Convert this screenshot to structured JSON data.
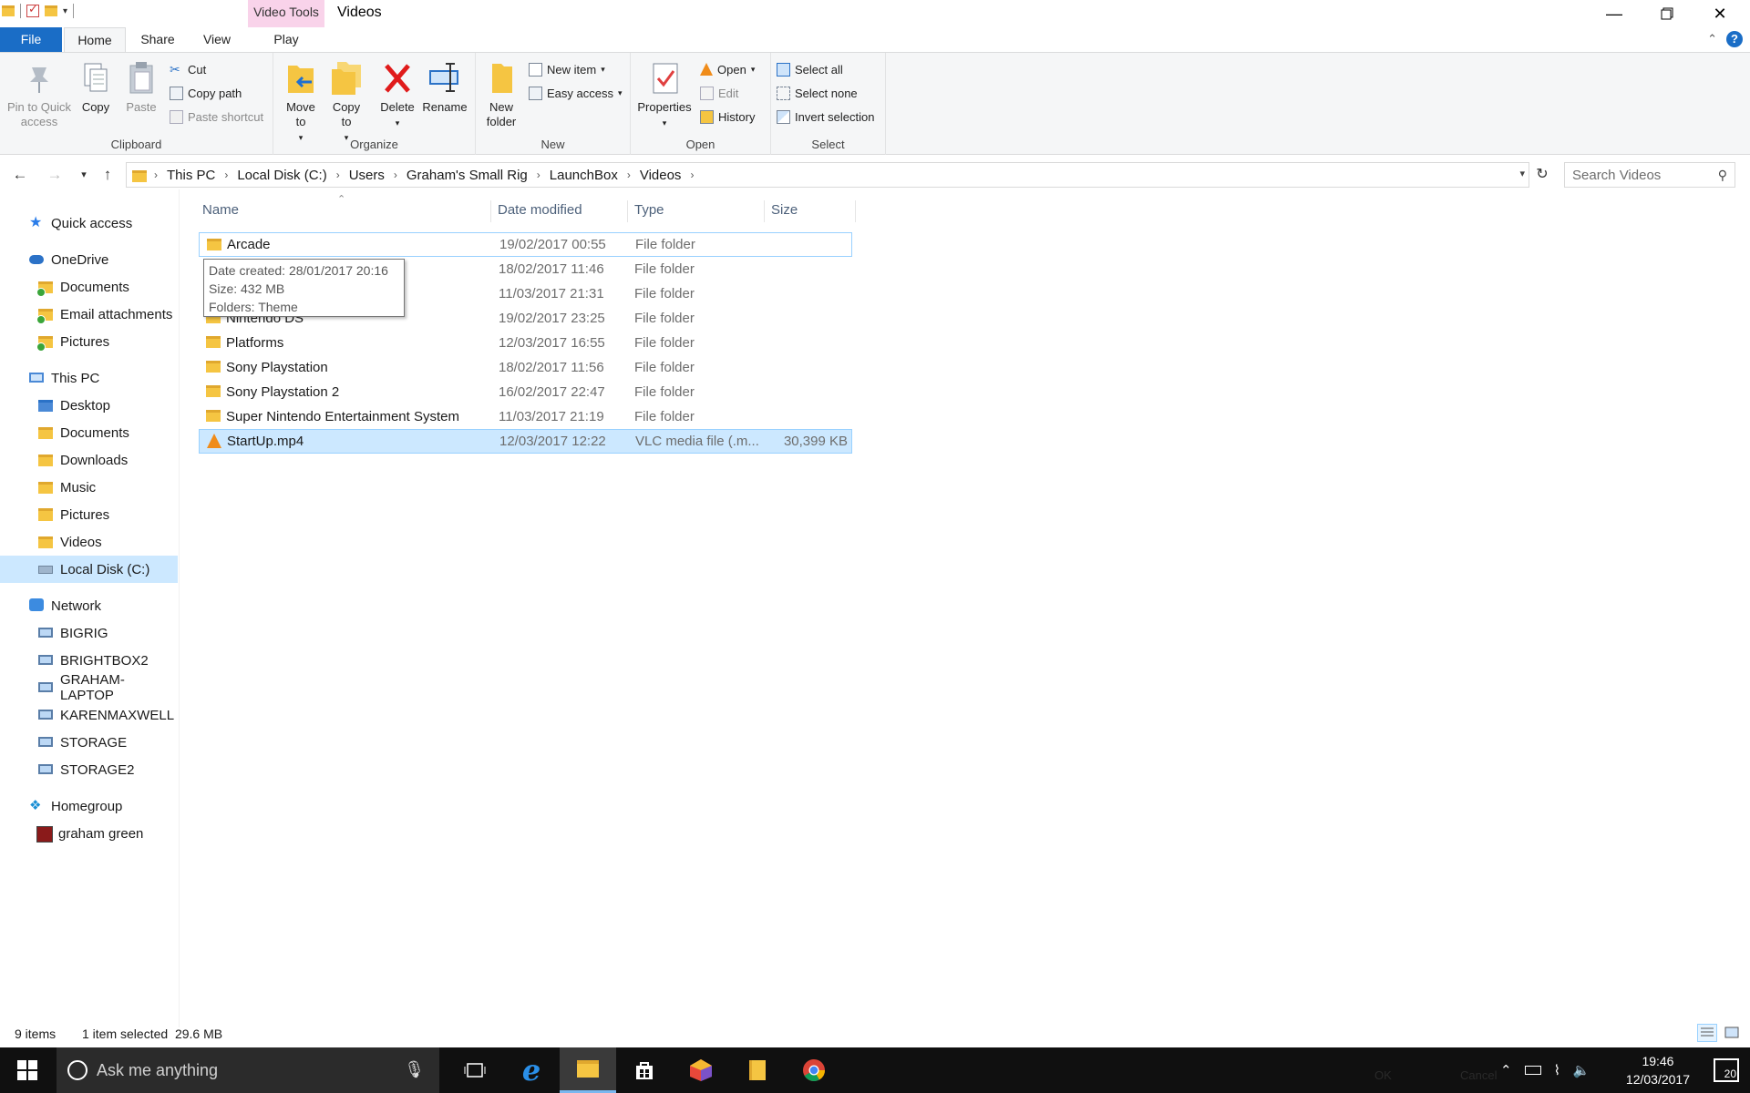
{
  "window": {
    "title": "Videos",
    "context_tab": "Video Tools"
  },
  "tabs": [
    "File",
    "Home",
    "Share",
    "View",
    "Play"
  ],
  "ribbon": {
    "clipboard": {
      "label": "Clipboard",
      "pin": "Pin to Quick access",
      "copy": "Copy",
      "paste": "Paste",
      "cut": "Cut",
      "copy_path": "Copy path",
      "paste_shortcut": "Paste shortcut"
    },
    "organize": {
      "label": "Organize",
      "move_to": "Move to",
      "copy_to": "Copy to",
      "delete": "Delete",
      "rename": "Rename"
    },
    "new": {
      "label": "New",
      "new_folder": "New folder",
      "new_item": "New item",
      "easy_access": "Easy access"
    },
    "open": {
      "label": "Open",
      "properties": "Properties",
      "open": "Open",
      "edit": "Edit",
      "history": "History"
    },
    "select": {
      "label": "Select",
      "select_all": "Select all",
      "select_none": "Select none",
      "invert": "Invert selection"
    }
  },
  "address": {
    "crumbs": [
      "This PC",
      "Local Disk (C:)",
      "Users",
      "Graham's Small Rig",
      "LaunchBox",
      "Videos"
    ],
    "search_placeholder": "Search Videos"
  },
  "nav": {
    "quick_access": "Quick access",
    "onedrive": "OneDrive",
    "onedrive_items": [
      "Documents",
      "Email attachments",
      "Pictures"
    ],
    "this_pc": "This PC",
    "this_pc_items": [
      "Desktop",
      "Documents",
      "Downloads",
      "Music",
      "Pictures",
      "Videos",
      "Local Disk (C:)"
    ],
    "network": "Network",
    "network_items": [
      "BIGRIG",
      "BRIGHTBOX2",
      "GRAHAM-LAPTOP",
      "KARENMAXWELL",
      "STORAGE",
      "STORAGE2"
    ],
    "homegroup": "Homegroup",
    "homegroup_items": [
      "graham green"
    ]
  },
  "columns": {
    "name": "Name",
    "date": "Date modified",
    "type": "Type",
    "size": "Size"
  },
  "files": [
    {
      "name": "Arcade",
      "date": "19/02/2017 00:55",
      "type": "File folder",
      "size": ""
    },
    {
      "name": "",
      "date": "18/02/2017 11:46",
      "type": "File folder",
      "size": ""
    },
    {
      "name": "",
      "date": "11/03/2017 21:31",
      "type": "File folder",
      "size": ""
    },
    {
      "name": "Nintendo DS",
      "date": "19/02/2017 23:25",
      "type": "File folder",
      "size": ""
    },
    {
      "name": "Platforms",
      "date": "12/03/2017 16:55",
      "type": "File folder",
      "size": ""
    },
    {
      "name": "Sony Playstation",
      "date": "18/02/2017 11:56",
      "type": "File folder",
      "size": ""
    },
    {
      "name": "Sony Playstation 2",
      "date": "16/02/2017 22:47",
      "type": "File folder",
      "size": ""
    },
    {
      "name": "Super Nintendo Entertainment System",
      "date": "11/03/2017 21:19",
      "type": "File folder",
      "size": ""
    },
    {
      "name": "StartUp.mp4",
      "date": "12/03/2017 12:22",
      "type": "VLC media file (.m...",
      "size": "30,399 KB"
    }
  ],
  "tooltip": {
    "line1": "Date created: 28/01/2017 20:16",
    "line2": "Size: 432 MB",
    "line3": "Folders: Theme"
  },
  "status": {
    "items": "9 items",
    "selected": "1 item selected  29.6 MB"
  },
  "taskbar": {
    "search_text": "Ask me anything",
    "time": "19:46",
    "date": "12/03/2017",
    "notifications": "20",
    "ghost_ok": "OK",
    "ghost_cancel": "Cancel"
  },
  "colors": {
    "file_tab": "#1a6dc6",
    "context_tab": "#f9d3ea",
    "selection": "#cce8ff",
    "selection_border": "#99d1ff",
    "taskbar": "#101010"
  }
}
